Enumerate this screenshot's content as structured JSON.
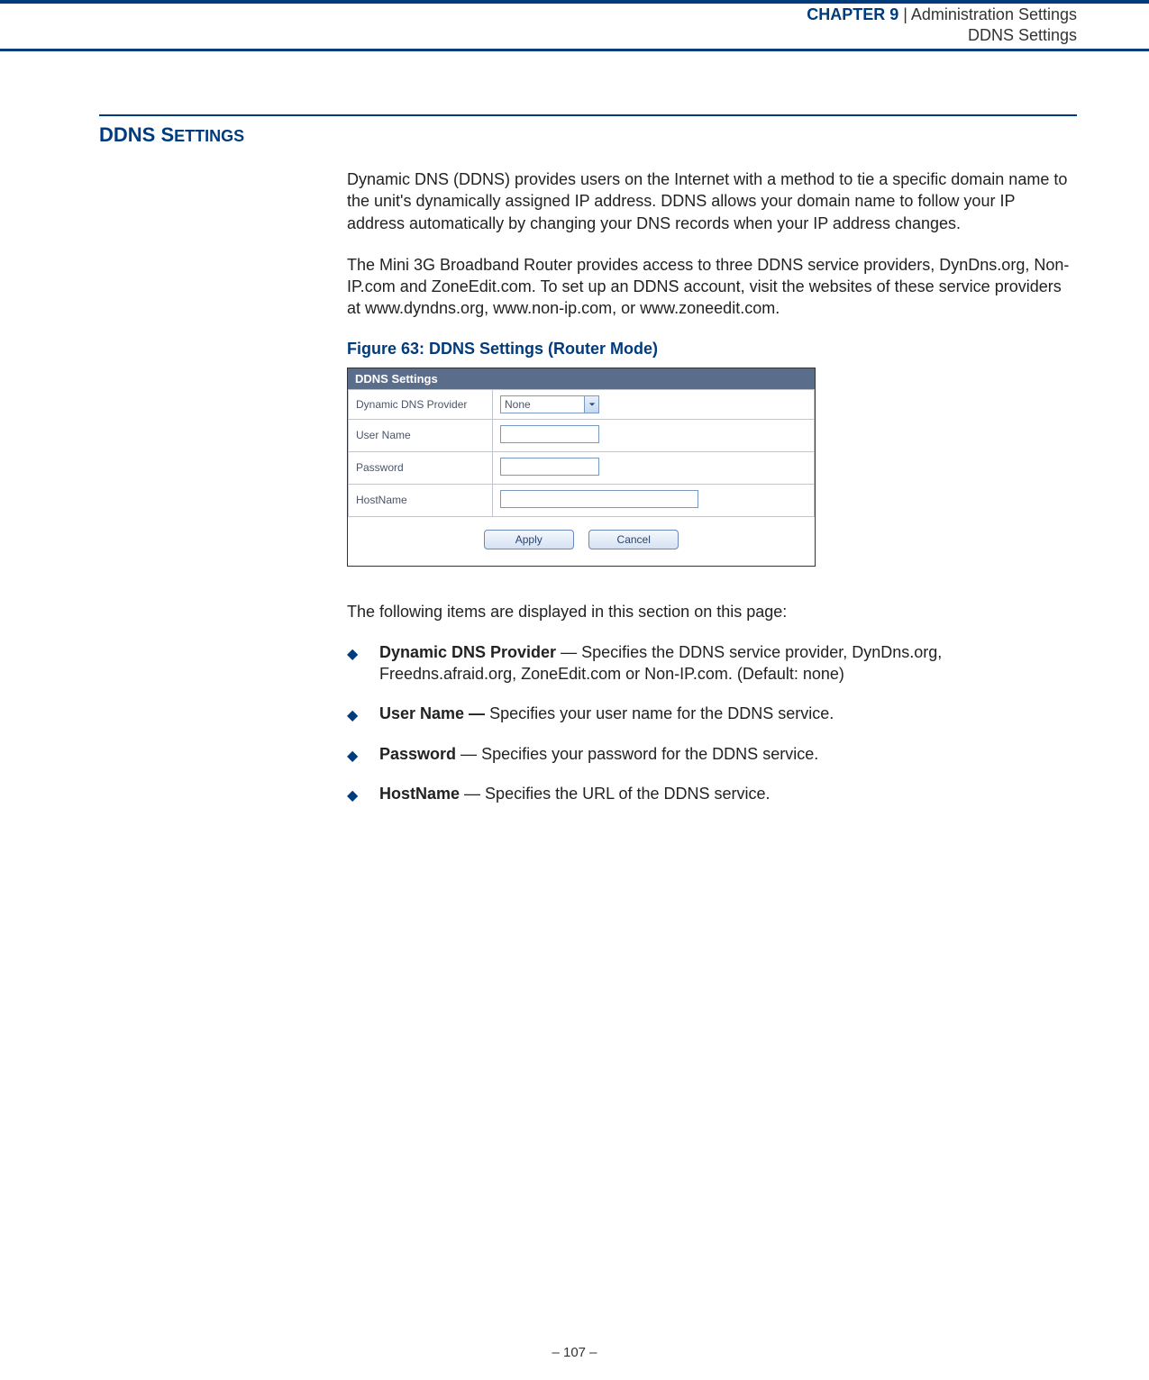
{
  "header": {
    "chapter_label": "CHAPTER 9",
    "separator": "  |  ",
    "chapter_title": "Administration Settings",
    "subtitle": "DDNS Settings"
  },
  "section": {
    "heading_prefix": "DDNS S",
    "heading_rest": "ETTINGS",
    "para1": "Dynamic DNS (DDNS) provides users on the Internet with a method to tie a specific domain name to the unit's dynamically assigned IP address. DDNS allows your domain name to follow your IP address automatically by changing your DNS records when your IP address changes.",
    "para2": "The Mini 3G Broadband Router provides access to three DDNS service providers, DynDns.org, Non-IP.com and ZoneEdit.com. To set up an DDNS account, visit the websites of these service providers at www.dyndns.org, www.non-ip.com, or www.zoneedit.com.",
    "figure_caption": "Figure 63:  DDNS Settings (Router Mode)"
  },
  "screenshot": {
    "panel_title": "DDNS Settings",
    "rows": {
      "provider_label": "Dynamic DNS Provider",
      "provider_value": "None",
      "username_label": "User Name",
      "password_label": "Password",
      "hostname_label": "HostName"
    },
    "buttons": {
      "apply": "Apply",
      "cancel": "Cancel"
    }
  },
  "items": {
    "intro": "The following items are displayed in this section on this page:",
    "list": [
      {
        "term": "Dynamic DNS Provider",
        "sep": " — ",
        "desc": "Specifies the DDNS service provider, DynDns.org, Freedns.afraid.org, ZoneEdit.com or Non-IP.com. (Default: none)"
      },
      {
        "term": "User Name —",
        "sep": " ",
        "desc": "Specifies your user name for the DDNS service."
      },
      {
        "term": "Password",
        "sep": " — ",
        "desc": "Specifies your password for the DDNS service."
      },
      {
        "term": "HostName",
        "sep": " — ",
        "desc": "Specifies the URL of the DDNS service."
      }
    ]
  },
  "footer": {
    "page_number": "–  107  –"
  }
}
